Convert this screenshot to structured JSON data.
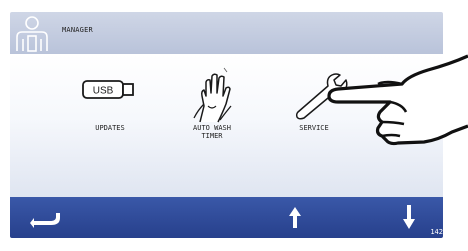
{
  "header": {
    "title": "MANAGER"
  },
  "tiles": [
    {
      "label": "UPDATES",
      "icon": "usb-icon",
      "badge": "USB"
    },
    {
      "label": "AUTO WASH\nTIMER",
      "icon": "hand-wash-icon"
    },
    {
      "label": "SERVICE",
      "icon": "wrench-icon"
    }
  ],
  "footer": {
    "back_icon": "back-arrow-icon",
    "up_icon": "arrow-up-icon",
    "down_icon": "arrow-down-icon",
    "page_number": "142"
  },
  "colors": {
    "header_bg": "#c4cce0",
    "footer_bg": "#2f4b9a",
    "icon_stroke": "#1a1a1a"
  }
}
